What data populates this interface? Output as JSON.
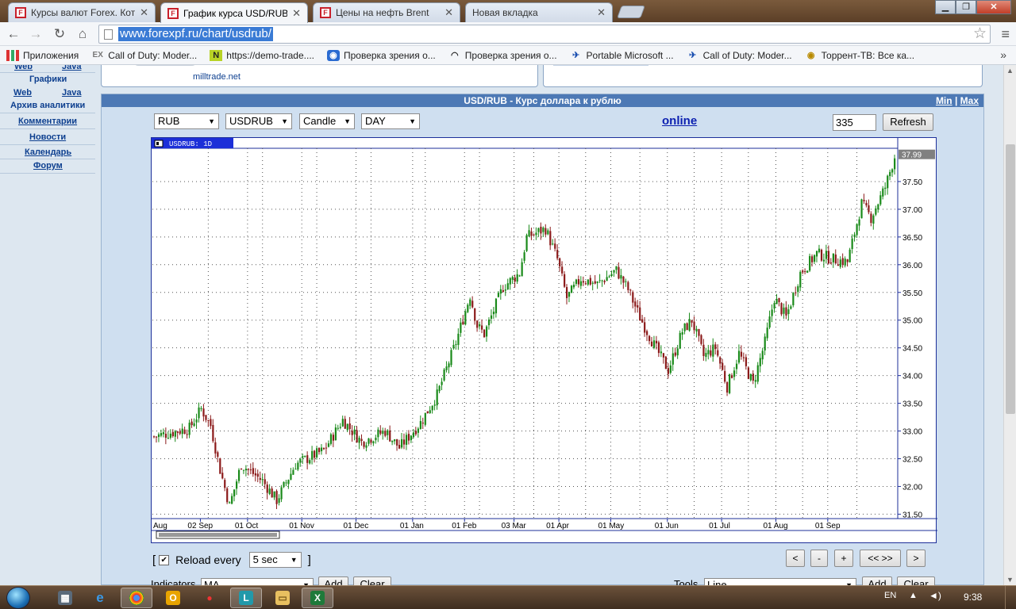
{
  "browser": {
    "tabs": [
      {
        "label": "Курсы валют Forex. Коти",
        "icon": "forexpf-favicon",
        "active": false
      },
      {
        "label": "График курса USD/RUB",
        "icon": "forexpf-favicon",
        "active": true
      },
      {
        "label": "Цены на нефть Brent",
        "icon": "forexpf-favicon",
        "active": false
      },
      {
        "label": "Новая вкладка",
        "icon": "blank-page",
        "active": false
      }
    ],
    "url": "www.forexpf.ru/chart/usdrub/",
    "bookmarks": [
      {
        "label": "Приложения",
        "icon": "apps-grid-icon"
      },
      {
        "label": "Call of Duty: Moder...",
        "icon": "ex-icon"
      },
      {
        "label": "https://demo-trade....",
        "icon": "n-icon"
      },
      {
        "label": "Проверка зрения о...",
        "icon": "eye-icon"
      },
      {
        "label": "Проверка зрения о...",
        "icon": "eye-outline-icon"
      },
      {
        "label": "Portable Microsoft ...",
        "icon": "bird-icon"
      },
      {
        "label": "Call of Duty: Moder...",
        "icon": "bird-icon"
      },
      {
        "label": "Торрент-ТВ: Все ка...",
        "icon": "torrent-eye-icon"
      }
    ]
  },
  "sidebar": {
    "web1": "Web",
    "java1": "Java",
    "charts": "Графики",
    "web2": "Web",
    "java2": "Java",
    "archive": "Архив аналитики",
    "comments": "Комментарии",
    "news": "Новости",
    "calendar": "Календарь",
    "forum": "Форум"
  },
  "top_banner": {
    "milltrade": "milltrade.net"
  },
  "panel": {
    "title": "USD/RUB - Курс доллара к рублю",
    "min": "Min",
    "sep": "|",
    "max": "Max",
    "controls": {
      "currency": "RUB",
      "pair": "USDRUB",
      "chart_type": "Candle",
      "period": "DAY",
      "online": "online",
      "count": "335",
      "refresh": "Refresh"
    },
    "reload": {
      "bracket_open": "[",
      "bracket_close": "]",
      "label": "Reload every",
      "value": "5 sec",
      "checked": true
    },
    "nav_buttons": [
      "<",
      "-",
      "+",
      "<< >>",
      ">"
    ],
    "indicators_label": "Indicators",
    "indicators_value": "MA",
    "add": "Add",
    "clear": "Clear",
    "tools_label": "Tools",
    "tools_value": "Line"
  },
  "chart_data": {
    "type": "candlestick",
    "symbol_label": "USDRUB: 1D",
    "last_price": "37.99",
    "ylim": [
      31.5,
      38.0
    ],
    "y_ticks": [
      "37.50",
      "37.00",
      "36.50",
      "36.00",
      "35.50",
      "35.00",
      "34.50",
      "34.00",
      "33.50",
      "33.00",
      "32.50",
      "32.00",
      "31.50"
    ],
    "x_labels": [
      "Aug",
      "02 Sep",
      "01 Oct",
      "01 Nov",
      "01 Dec",
      "01 Jan",
      "01 Feb",
      "03 Mar",
      "01 Apr",
      "01 May",
      "01 Jun",
      "01 Jul",
      "01 Aug",
      "01 Sep"
    ],
    "bullish_color": "#1a8a1a",
    "bearish_color": "#8b1a1a",
    "close_trend": [
      {
        "i": 0,
        "c": 32.9
      },
      {
        "i": 15,
        "c": 33.05
      },
      {
        "i": 20,
        "c": 33.4
      },
      {
        "i": 24,
        "c": 33.1
      },
      {
        "i": 28,
        "c": 32.3
      },
      {
        "i": 32,
        "c": 31.65
      },
      {
        "i": 37,
        "c": 32.4
      },
      {
        "i": 46,
        "c": 32.1
      },
      {
        "i": 52,
        "c": 31.75
      },
      {
        "i": 60,
        "c": 32.4
      },
      {
        "i": 72,
        "c": 32.65
      },
      {
        "i": 80,
        "c": 33.2
      },
      {
        "i": 88,
        "c": 32.8
      },
      {
        "i": 98,
        "c": 33.0
      },
      {
        "i": 104,
        "c": 32.7
      },
      {
        "i": 113,
        "c": 33.15
      },
      {
        "i": 120,
        "c": 33.65
      },
      {
        "i": 128,
        "c": 34.6
      },
      {
        "i": 134,
        "c": 35.45
      },
      {
        "i": 137,
        "c": 34.9
      },
      {
        "i": 140,
        "c": 34.75
      },
      {
        "i": 148,
        "c": 35.6
      },
      {
        "i": 155,
        "c": 35.85
      },
      {
        "i": 158,
        "c": 36.5
      },
      {
        "i": 166,
        "c": 36.65
      },
      {
        "i": 171,
        "c": 36.1
      },
      {
        "i": 175,
        "c": 35.4
      },
      {
        "i": 181,
        "c": 35.75
      },
      {
        "i": 188,
        "c": 35.65
      },
      {
        "i": 196,
        "c": 35.9
      },
      {
        "i": 201,
        "c": 35.55
      },
      {
        "i": 206,
        "c": 35.05
      },
      {
        "i": 212,
        "c": 34.55
      },
      {
        "i": 218,
        "c": 34.1
      },
      {
        "i": 224,
        "c": 34.8
      },
      {
        "i": 228,
        "c": 35.0
      },
      {
        "i": 233,
        "c": 34.35
      },
      {
        "i": 238,
        "c": 34.5
      },
      {
        "i": 243,
        "c": 33.8
      },
      {
        "i": 248,
        "c": 34.4
      },
      {
        "i": 254,
        "c": 33.85
      },
      {
        "i": 259,
        "c": 34.6
      },
      {
        "i": 263,
        "c": 35.4
      },
      {
        "i": 268,
        "c": 35.05
      },
      {
        "i": 274,
        "c": 35.85
      },
      {
        "i": 281,
        "c": 36.2
      },
      {
        "i": 288,
        "c": 36.1
      },
      {
        "i": 294,
        "c": 36.05
      },
      {
        "i": 300,
        "c": 37.1
      },
      {
        "i": 304,
        "c": 36.85
      },
      {
        "i": 310,
        "c": 37.4
      },
      {
        "i": 314,
        "c": 37.95
      }
    ],
    "candle_count": 315
  }
}
